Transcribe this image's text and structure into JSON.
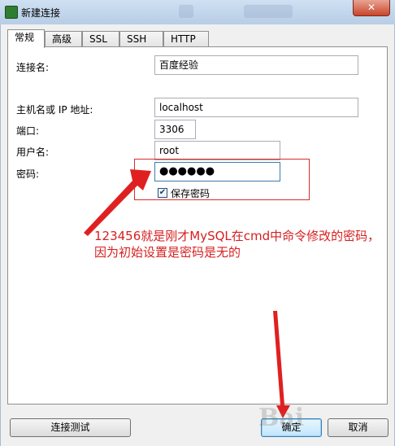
{
  "window": {
    "title": "新建连接",
    "close_label": "✕"
  },
  "tabs": [
    {
      "label": "常规",
      "active": true
    },
    {
      "label": "高级"
    },
    {
      "label": "SSL"
    },
    {
      "label": "SSH"
    },
    {
      "label": "HTTP"
    }
  ],
  "form": {
    "connection_name_label": "连接名:",
    "connection_name_value": "百度经验",
    "host_label": "主机名或 IP 地址:",
    "host_value": "localhost",
    "port_label": "端口:",
    "port_value": "3306",
    "user_label": "用户名:",
    "user_value": "root",
    "password_label": "密码:",
    "password_value": "●●●●●●",
    "save_password_label": "保存密码",
    "save_password_checked": true
  },
  "annotation": {
    "line1": "123456就是刚才MySQL在cmd中命令修改的密码，",
    "line2": "因为初始设置是密码是无的",
    "color": "#d62020"
  },
  "buttons": {
    "test_connection": "连接测试",
    "ok": "确定",
    "cancel": "取消"
  }
}
